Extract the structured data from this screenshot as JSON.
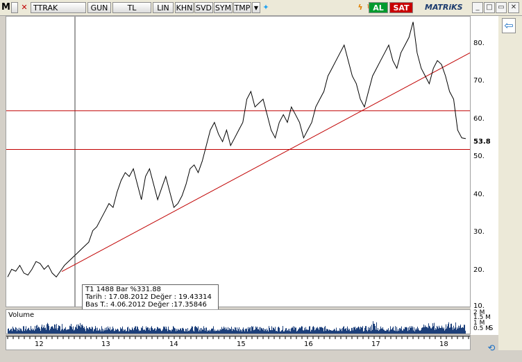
{
  "toolbar": {
    "logo": "M",
    "symbol": "TTRAK",
    "period": "GUN",
    "currency": "TL",
    "scale": "LIN",
    "buttons": [
      "KHN",
      "SVD",
      "SYM",
      "TMP"
    ],
    "al_label": "AL",
    "sat_label": "SAT",
    "brand": "MATRiKS"
  },
  "chart": {
    "y_ticks": [
      "80.",
      "70.",
      "60.",
      "50.",
      "40.",
      "30.",
      "20.",
      "10."
    ],
    "last_price_label": "53.8",
    "x_ticks": [
      "12",
      "13",
      "14",
      "15",
      "16",
      "17",
      "18"
    ]
  },
  "info_box": {
    "line1": "T1   1488 Bar   %331.88",
    "line2": "Tarih : 17.08.2012 Değer : 19.43314",
    "line3": "Bas T.: 4.06.2012  Değer :17.35846",
    "line4": "-"
  },
  "volume": {
    "label": "Volume",
    "ticks": [
      "2 M",
      "1.5 M",
      "1 M",
      "0.5 M"
    ]
  },
  "side": {
    "s_label": "S"
  },
  "chart_data": {
    "type": "line",
    "x_range": [
      "2012",
      "2018"
    ],
    "ylim": [
      10,
      85
    ],
    "horizontal_lines": [
      61,
      51
    ],
    "trend_line": {
      "start": {
        "x": "2012-08-17",
        "y": 19.4
      },
      "end": {
        "x": "2018-05",
        "y": 76
      }
    },
    "series": [
      {
        "values": [
          18,
          20,
          19.5,
          21,
          19,
          18.5,
          20,
          22,
          21.5,
          20,
          21,
          19,
          18,
          19.5,
          21,
          22,
          23,
          24,
          25,
          26,
          27,
          30,
          31,
          33,
          35,
          37,
          36,
          40,
          43,
          45,
          44,
          46,
          42,
          38,
          44,
          46,
          42,
          38,
          41,
          44,
          40,
          36,
          37,
          39,
          42,
          46,
          47,
          45,
          48,
          52,
          56,
          58,
          55,
          53,
          56,
          52,
          54,
          56,
          58,
          64,
          66,
          62,
          63,
          64,
          60,
          56,
          54,
          58,
          60,
          58,
          62,
          60,
          58,
          54,
          56,
          58,
          62,
          64,
          66,
          70,
          72,
          74,
          76,
          78,
          74,
          70,
          68,
          64,
          62,
          66,
          70,
          72,
          74,
          76,
          78,
          74,
          72,
          76,
          78,
          80,
          84,
          76,
          72,
          70,
          68,
          72,
          74,
          73,
          70,
          66,
          64,
          56,
          54,
          53.8
        ]
      }
    ]
  },
  "colors": {
    "price_line": "#000000",
    "trend_line": "#c00000",
    "horizontal_line": "#c00000",
    "volume_bars": "#1c3f7a",
    "al": "#009a2e",
    "sat": "#c80000"
  }
}
